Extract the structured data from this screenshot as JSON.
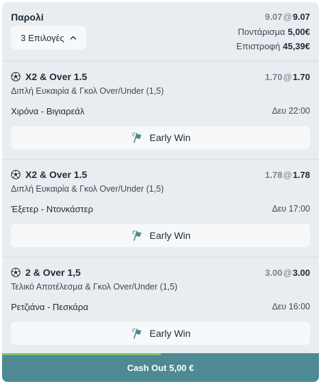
{
  "header": {
    "title": "Παρολί",
    "odds_old": "9.07",
    "odds_at": "@",
    "odds_new": "9.07",
    "selections_label": "3 Επιλογές",
    "stake_label": "Ποντάρισμα",
    "stake_value": "5,00€",
    "return_label": "Επιστροφή",
    "return_value": "45,39€"
  },
  "selections": [
    {
      "icon": "soccer-ball-icon",
      "market": "X2 & Over 1.5",
      "odds_old": "1.70",
      "odds_at": "@",
      "odds_new": "1.70",
      "description": "Διπλή Ευκαιρία & Γκολ Over/Under (1,5)",
      "match": "Χιρόνα - Βιγιαρεάλ",
      "time": "Δευ 22:00",
      "early_win_label": "Early Win"
    },
    {
      "icon": "soccer-ball-icon",
      "market": "X2 & Over 1.5",
      "odds_old": "1.78",
      "odds_at": "@",
      "odds_new": "1.78",
      "description": "Διπλή Ευκαιρία & Γκολ Over/Under (1,5)",
      "match": "Έξετερ - Ντονκάστερ",
      "time": "Δευ 17:00",
      "early_win_label": "Early Win"
    },
    {
      "icon": "soccer-ball-icon",
      "market": "2 & Over 1,5",
      "odds_old": "3.00",
      "odds_at": "@",
      "odds_new": "3.00",
      "description": "Τελικό Αποτέλεσμα & Γκολ Over/Under (1,5)",
      "match": "Ρετζιάνα - Πεσκάρα",
      "time": "Δευ 16:00",
      "early_win_label": "Early Win"
    }
  ],
  "cashout": {
    "label": "Cash Out 5,00 €",
    "progress_fraction": 0.5
  },
  "colors": {
    "card_bg": "#e9edf1",
    "button_bg": "#f6f8fa",
    "cashout_bg": "#4d8a93",
    "progress": "#7dc36b",
    "early_win_icon": "#4d8a93"
  }
}
